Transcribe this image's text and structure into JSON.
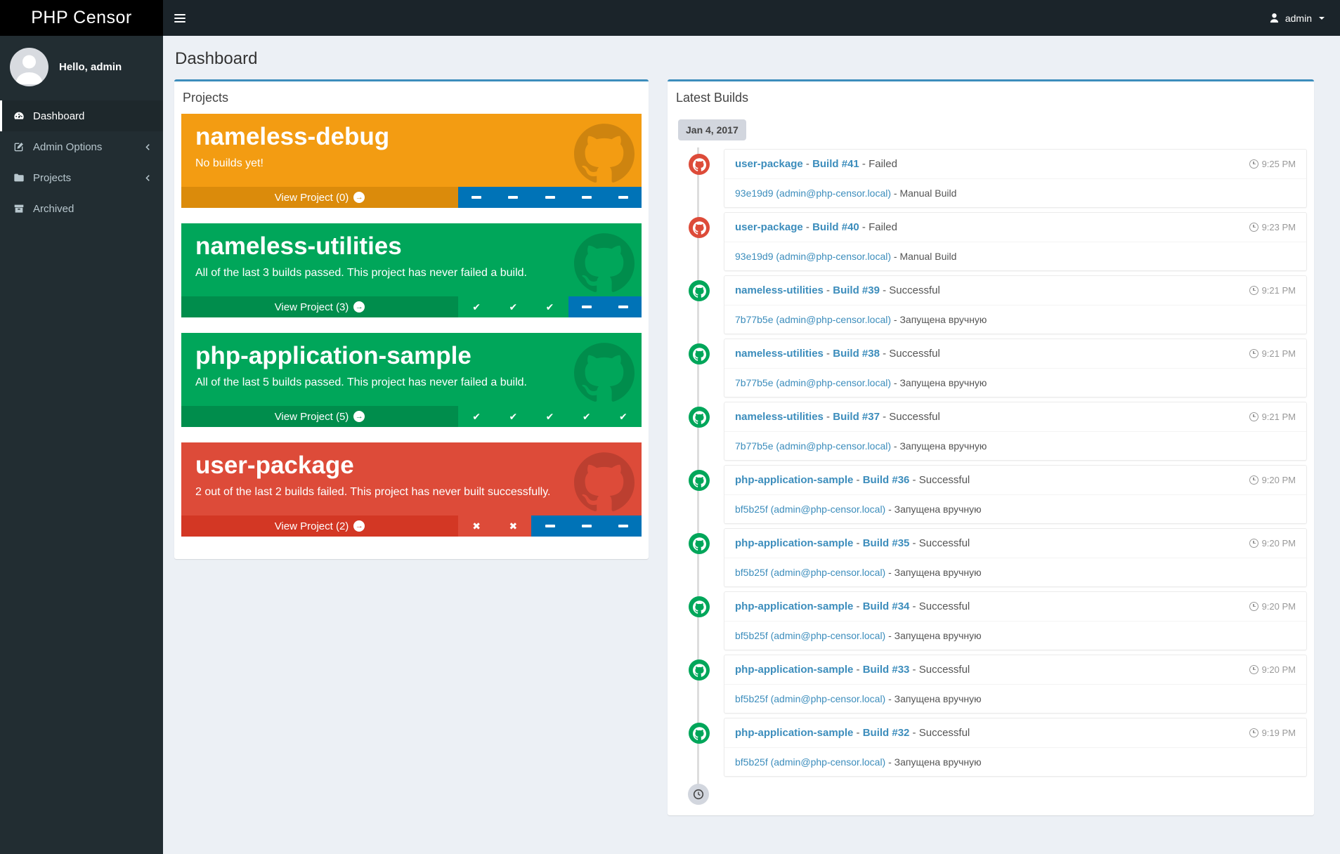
{
  "app": {
    "title": "PHP Censor"
  },
  "navbar": {
    "username": "admin"
  },
  "sidebar": {
    "greeting": "Hello, admin",
    "items": [
      {
        "label": "Dashboard",
        "icon": "dashboard-icon",
        "active": true,
        "chevron": false
      },
      {
        "label": "Admin Options",
        "icon": "edit-icon",
        "active": false,
        "chevron": true
      },
      {
        "label": "Projects",
        "icon": "folder-icon",
        "active": false,
        "chevron": true
      },
      {
        "label": "Archived",
        "icon": "archive-icon",
        "active": false,
        "chevron": false
      }
    ]
  },
  "page": {
    "title": "Dashboard"
  },
  "icons": {
    "arrow_right": "→",
    "check": "✔",
    "cross": "✖"
  },
  "colors": {
    "accent": "#3c8dbc",
    "success": "#00a65a",
    "success_dark": "#008d4c",
    "danger": "#dd4b39",
    "danger_dark": "#d33724",
    "warning": "#f39c12",
    "warning_dark": "#db8b0b",
    "neutral_blue": "#0073b7",
    "navbar_bg": "#1b242a",
    "sidebar_bg": "#222d32",
    "logo_bg": "#000000"
  },
  "projects_panel": {
    "title": "Projects",
    "cards": [
      {
        "name": "nameless-debug",
        "description": "No builds yet!",
        "color": "#f39c12",
        "footer_color": "#db8b0b",
        "view_label": "View Project (0)",
        "builds": [
          "none",
          "none",
          "none",
          "none",
          "none"
        ]
      },
      {
        "name": "nameless-utilities",
        "description": "All of the last 3 builds passed. This project has never failed a build.",
        "color": "#00a65a",
        "footer_color": "#008d4c",
        "view_label": "View Project (3)",
        "builds": [
          "ok",
          "ok",
          "ok",
          "none",
          "none"
        ]
      },
      {
        "name": "php-application-sample",
        "description": "All of the last 5 builds passed. This project has never failed a build.",
        "color": "#00a65a",
        "footer_color": "#008d4c",
        "view_label": "View Project (5)",
        "builds": [
          "ok",
          "ok",
          "ok",
          "ok",
          "ok"
        ]
      },
      {
        "name": "user-package",
        "description": "2 out of the last 2 builds failed. This project has never built successfully.",
        "color": "#dd4b39",
        "footer_color": "#d33724",
        "view_label": "View Project (2)",
        "builds": [
          "fail",
          "fail",
          "none",
          "none",
          "none"
        ]
      }
    ]
  },
  "builds_panel": {
    "title": "Latest Builds",
    "date_label": "Jan 4, 2017",
    "separator": " - ",
    "entries": [
      {
        "project": "user-package",
        "build": "Build #41",
        "status": "Failed",
        "status_type": "fail",
        "commit": "93e19d9 (admin@php-censor.local)",
        "note": "Manual Build",
        "time": "9:25 PM"
      },
      {
        "project": "user-package",
        "build": "Build #40",
        "status": "Failed",
        "status_type": "fail",
        "commit": "93e19d9 (admin@php-censor.local)",
        "note": "Manual Build",
        "time": "9:23 PM"
      },
      {
        "project": "nameless-utilities",
        "build": "Build #39",
        "status": "Successful",
        "status_type": "ok",
        "commit": "7b77b5e (admin@php-censor.local)",
        "note": "Запущена вручную",
        "time": "9:21 PM"
      },
      {
        "project": "nameless-utilities",
        "build": "Build #38",
        "status": "Successful",
        "status_type": "ok",
        "commit": "7b77b5e (admin@php-censor.local)",
        "note": "Запущена вручную",
        "time": "9:21 PM"
      },
      {
        "project": "nameless-utilities",
        "build": "Build #37",
        "status": "Successful",
        "status_type": "ok",
        "commit": "7b77b5e (admin@php-censor.local)",
        "note": "Запущена вручную",
        "time": "9:21 PM"
      },
      {
        "project": "php-application-sample",
        "build": "Build #36",
        "status": "Successful",
        "status_type": "ok",
        "commit": "bf5b25f (admin@php-censor.local)",
        "note": "Запущена вручную",
        "time": "9:20 PM"
      },
      {
        "project": "php-application-sample",
        "build": "Build #35",
        "status": "Successful",
        "status_type": "ok",
        "commit": "bf5b25f (admin@php-censor.local)",
        "note": "Запущена вручную",
        "time": "9:20 PM"
      },
      {
        "project": "php-application-sample",
        "build": "Build #34",
        "status": "Successful",
        "status_type": "ok",
        "commit": "bf5b25f (admin@php-censor.local)",
        "note": "Запущена вручную",
        "time": "9:20 PM"
      },
      {
        "project": "php-application-sample",
        "build": "Build #33",
        "status": "Successful",
        "status_type": "ok",
        "commit": "bf5b25f (admin@php-censor.local)",
        "note": "Запущена вручную",
        "time": "9:20 PM"
      },
      {
        "project": "php-application-sample",
        "build": "Build #32",
        "status": "Successful",
        "status_type": "ok",
        "commit": "bf5b25f (admin@php-censor.local)",
        "note": "Запущена вручную",
        "time": "9:19 PM"
      }
    ]
  }
}
